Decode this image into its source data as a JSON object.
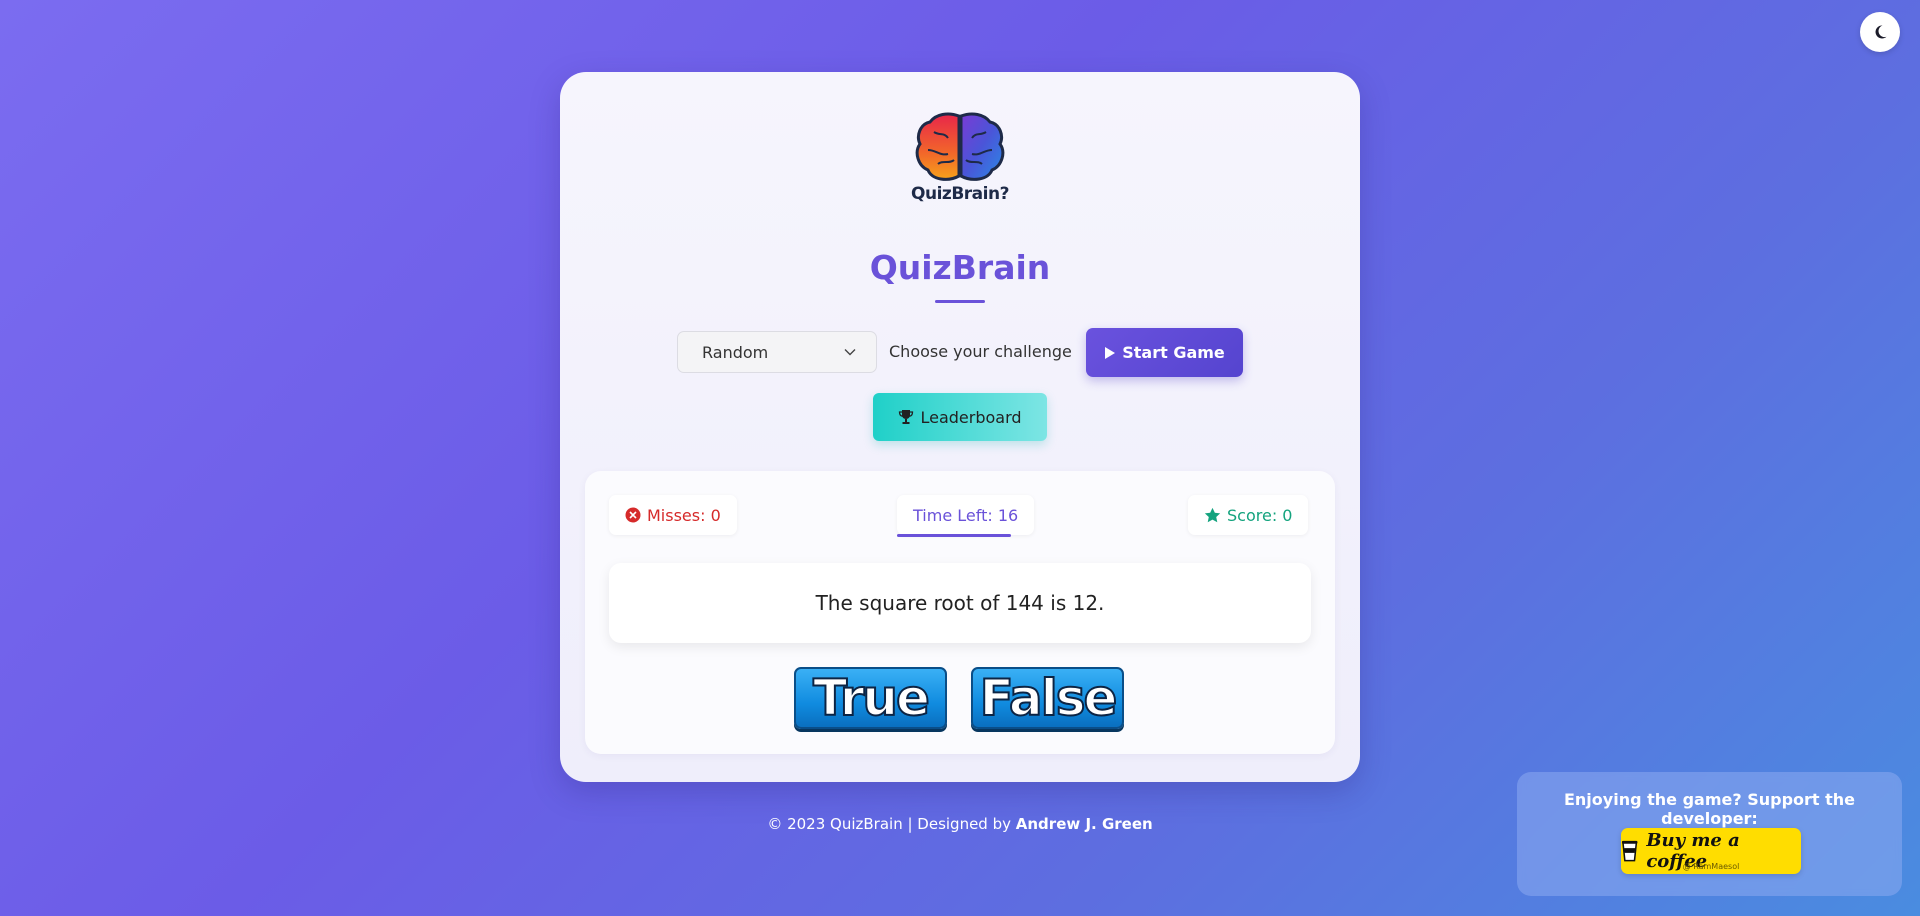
{
  "header": {
    "logo_text": "QuizBrain?",
    "title": "QuizBrain"
  },
  "controls": {
    "category_selected": "Random",
    "choose_label": "Choose your challenge",
    "start_label": "Start Game",
    "leaderboard_label": "Leaderboard"
  },
  "stats": {
    "misses_label": "Misses: 0",
    "time_label": "Time Left: 16",
    "score_label": "Score: 0"
  },
  "question": {
    "text": "The square root of 144 is 12."
  },
  "answers": {
    "true_label": "True",
    "false_label": "False"
  },
  "footer": {
    "prefix": "© 2023 QuizBrain | Designed by ",
    "author": "Andrew J. Green"
  },
  "support": {
    "text": "Enjoying the game? Support the developer:",
    "coffee_label": "Buy me a coffee",
    "coffee_sub": "@ RamMaesol"
  },
  "colors": {
    "accent": "#6a52d9",
    "teal": "#1fd0c8",
    "miss_red": "#d62a2a",
    "score_green": "#14a37e",
    "coffee_yellow": "#ffdd00"
  },
  "icons": {
    "theme": "moon-icon",
    "start": "play-icon",
    "leaderboard": "trophy-icon",
    "misses": "x-circle-icon",
    "score": "star-icon",
    "coffee": "coffee-cup-icon",
    "select": "chevron-down-icon"
  }
}
